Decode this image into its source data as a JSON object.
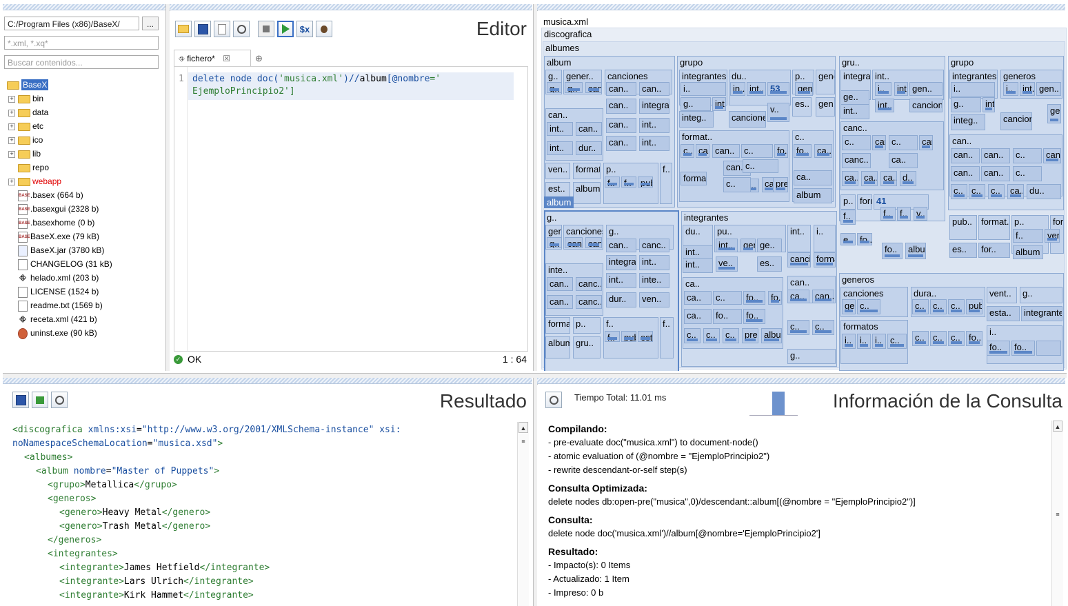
{
  "project": {
    "path": "C:/Program Files (x86)/BaseX/",
    "browse_label": "...",
    "filter_value": "*.xml, *.xq*",
    "search_placeholder": "Buscar contenidos...",
    "tree": [
      {
        "label": "BaseX",
        "kind": "folder",
        "selected": true,
        "expander": ""
      },
      {
        "label": "bin",
        "kind": "folder",
        "expander": "+"
      },
      {
        "label": "data",
        "kind": "folder",
        "expander": "+"
      },
      {
        "label": "etc",
        "kind": "folder",
        "expander": "+"
      },
      {
        "label": "ico",
        "kind": "folder",
        "expander": "+"
      },
      {
        "label": "lib",
        "kind": "folder",
        "expander": "+"
      },
      {
        "label": "repo",
        "kind": "folder",
        "expander": ""
      },
      {
        "label": "webapp",
        "kind": "folder",
        "expander": "+",
        "color": "#e00000"
      },
      {
        "label": ".basex (664 b)",
        "kind": "basex"
      },
      {
        "label": ".basexgui (2328 b)",
        "kind": "basex"
      },
      {
        "label": ".basexhome (0 b)",
        "kind": "basex"
      },
      {
        "label": "BaseX.exe (79 kB)",
        "kind": "basex"
      },
      {
        "label": "BaseX.jar (3780 kB)",
        "kind": "jar"
      },
      {
        "label": "CHANGELOG (31 kB)",
        "kind": "file"
      },
      {
        "label": "helado.xml (203 b)",
        "kind": "xml"
      },
      {
        "label": "LICENSE (1524 b)",
        "kind": "file"
      },
      {
        "label": "readme.txt (1569 b)",
        "kind": "txt"
      },
      {
        "label": "receta.xml (421 b)",
        "kind": "xml"
      },
      {
        "label": "uninst.exe (90 kB)",
        "kind": "exe"
      }
    ]
  },
  "editor": {
    "title": "Editor",
    "tab_label": "fichero*",
    "tab_close": "☒",
    "tab_add": "⊕",
    "line_number": "1",
    "code_line1_a": "delete node doc(",
    "code_line1_b": "'musica.xml'",
    "code_line1_c": ")//",
    "code_line1_d": "album",
    "code_line1_e": "[",
    "code_line1_f": "@nombre",
    "code_line1_g": "='",
    "code_line2": "EjemploPrincipio2']",
    "status_text": "OK",
    "cursor_pos": "1 : 64",
    "toolbar_icons": [
      "open-icon",
      "save-icon",
      "blank-icon",
      "find-icon",
      "stop-icon",
      "run-icon",
      "variables-icon",
      "debug-icon"
    ],
    "var_label": "$x"
  },
  "map": {
    "file": "musica.xml",
    "root": "discografica",
    "albumes": "albumes",
    "hover_label": "album",
    "cells": [
      {
        "t": "album"
      },
      {
        "t": "g.."
      },
      {
        "t": "gener.."
      },
      {
        "t": "canciones"
      },
      {
        "t": "g.."
      },
      {
        "t": "g.."
      },
      {
        "t": "can.."
      },
      {
        "t": "can.."
      },
      {
        "t": "can.."
      },
      {
        "t": "can.."
      },
      {
        "t": "integrantes"
      },
      {
        "t": "can.."
      },
      {
        "t": "can.."
      },
      {
        "t": "int.."
      },
      {
        "t": "int.."
      },
      {
        "t": "can.."
      },
      {
        "t": "can.."
      },
      {
        "t": "int.."
      },
      {
        "t": "int.."
      },
      {
        "t": "dur.."
      },
      {
        "t": "ven.."
      },
      {
        "t": "formatos"
      },
      {
        "t": "p.."
      },
      {
        "t": "f.."
      },
      {
        "t": "f.."
      },
      {
        "t": "f.."
      },
      {
        "t": "publ.."
      },
      {
        "t": "est.."
      },
      {
        "t": "album"
      },
      {
        "t": "grupo"
      },
      {
        "t": "integrantes"
      },
      {
        "t": "du.."
      },
      {
        "t": "p.."
      },
      {
        "t": "generos"
      },
      {
        "t": "i.."
      },
      {
        "t": "in.."
      },
      {
        "t": "int.."
      },
      {
        "t": "53"
      },
      {
        "t": "gen.."
      },
      {
        "t": "g.."
      },
      {
        "t": "int.."
      },
      {
        "t": "v.."
      },
      {
        "t": "es.."
      },
      {
        "t": "gen.."
      },
      {
        "t": "integ.."
      },
      {
        "t": "canciones"
      },
      {
        "t": "format.."
      },
      {
        "t": "c.."
      },
      {
        "t": "c.."
      },
      {
        "t": "ca.."
      },
      {
        "t": "can.."
      },
      {
        "t": "c.."
      },
      {
        "t": "fo.."
      },
      {
        "t": "fo.."
      },
      {
        "t": "ca.."
      },
      {
        "t": "can.."
      },
      {
        "t": "c.."
      },
      {
        "t": "c.."
      },
      {
        "t": "forma.."
      },
      {
        "t": "ca.."
      },
      {
        "t": "c.."
      },
      {
        "t": "ca.."
      },
      {
        "t": "precio"
      },
      {
        "t": "album"
      },
      {
        "t": "gru.."
      },
      {
        "t": "integrantes"
      },
      {
        "t": "int.."
      },
      {
        "t": "i.."
      },
      {
        "t": "int.."
      },
      {
        "t": "gen.."
      },
      {
        "t": "ge.."
      },
      {
        "t": "int.."
      },
      {
        "t": "int.."
      },
      {
        "t": "canciones"
      },
      {
        "t": "canc.."
      },
      {
        "t": "c.."
      },
      {
        "t": "canc.."
      },
      {
        "t": "c.."
      },
      {
        "t": "canc.."
      },
      {
        "t": "canc.."
      },
      {
        "t": "ca.."
      },
      {
        "t": "ca.."
      },
      {
        "t": "ca.."
      },
      {
        "t": "ca.."
      },
      {
        "t": "d.."
      },
      {
        "t": "p.."
      },
      {
        "t": "formatos"
      },
      {
        "t": "41"
      },
      {
        "t": "f.."
      },
      {
        "t": "f.."
      },
      {
        "t": "f.."
      },
      {
        "t": "v.."
      },
      {
        "t": "e.."
      },
      {
        "t": "fo.."
      },
      {
        "t": "fo.."
      },
      {
        "t": "album"
      },
      {
        "t": "grupo"
      },
      {
        "t": "integrantes"
      },
      {
        "t": "generos"
      },
      {
        "t": "i.."
      },
      {
        "t": "i.."
      },
      {
        "t": "int.."
      },
      {
        "t": "gen.."
      },
      {
        "t": "g.."
      },
      {
        "t": "int.."
      },
      {
        "t": "gen.."
      },
      {
        "t": "integ.."
      },
      {
        "t": "canciones"
      },
      {
        "t": "can.."
      },
      {
        "t": "can.."
      },
      {
        "t": "can.."
      },
      {
        "t": "c.."
      },
      {
        "t": "can.."
      },
      {
        "t": "can.."
      },
      {
        "t": "can.."
      },
      {
        "t": "c.."
      },
      {
        "t": "c.."
      },
      {
        "t": "c.."
      },
      {
        "t": "c.."
      },
      {
        "t": "ca.."
      },
      {
        "t": "du.."
      },
      {
        "t": "pub.."
      },
      {
        "t": "format.."
      },
      {
        "t": "p.."
      },
      {
        "t": "for.."
      },
      {
        "t": "f.."
      },
      {
        "t": "ven.."
      },
      {
        "t": "es.."
      },
      {
        "t": "for.."
      },
      {
        "t": "album"
      },
      {
        "t": "g.."
      },
      {
        "t": "generos"
      },
      {
        "t": "canciones"
      },
      {
        "t": "g.."
      },
      {
        "t": "g.."
      },
      {
        "t": "can.."
      },
      {
        "t": "canc.."
      },
      {
        "t": "can.."
      },
      {
        "t": "canc.."
      },
      {
        "t": "integrantes"
      },
      {
        "t": "int.."
      },
      {
        "t": "inte.."
      },
      {
        "t": "can.."
      },
      {
        "t": "canc.."
      },
      {
        "t": "int.."
      },
      {
        "t": "inte.."
      },
      {
        "t": "can.."
      },
      {
        "t": "canc.."
      },
      {
        "t": "dur.."
      },
      {
        "t": "ven.."
      },
      {
        "t": "formatos"
      },
      {
        "t": "p.."
      },
      {
        "t": "f.."
      },
      {
        "t": "f.."
      },
      {
        "t": "f.."
      },
      {
        "t": "publ.."
      },
      {
        "t": "est.."
      },
      {
        "t": "album"
      },
      {
        "t": "gru.."
      },
      {
        "t": "integrantes"
      },
      {
        "t": "du.."
      },
      {
        "t": "pu.."
      },
      {
        "t": "int.."
      },
      {
        "t": "i.."
      },
      {
        "t": "int.."
      },
      {
        "t": "gen.."
      },
      {
        "t": "ge.."
      },
      {
        "t": "int.."
      },
      {
        "t": "int.."
      },
      {
        "t": "ve.."
      },
      {
        "t": "es.."
      },
      {
        "t": "canciones"
      },
      {
        "t": "formatos"
      },
      {
        "t": "ca.."
      },
      {
        "t": "can.."
      },
      {
        "t": "ca.."
      },
      {
        "t": "c.."
      },
      {
        "t": "fo.."
      },
      {
        "t": "fo.."
      },
      {
        "t": "ca.."
      },
      {
        "t": "can.."
      },
      {
        "t": "ca.."
      },
      {
        "t": "fo.."
      },
      {
        "t": "fo.."
      },
      {
        "t": "c.."
      },
      {
        "t": "c.."
      },
      {
        "t": "c.."
      },
      {
        "t": "c.."
      },
      {
        "t": "c.."
      },
      {
        "t": "precio"
      },
      {
        "t": "album"
      },
      {
        "t": "g.."
      },
      {
        "t": "generos"
      },
      {
        "t": "canciones"
      },
      {
        "t": "dura.."
      },
      {
        "t": "vent.."
      },
      {
        "t": "g.."
      },
      {
        "t": "ge.."
      },
      {
        "t": "c.."
      },
      {
        "t": "c.."
      },
      {
        "t": "c.."
      },
      {
        "t": "c.."
      },
      {
        "t": "publ.."
      },
      {
        "t": "esta.."
      },
      {
        "t": "integrantes"
      },
      {
        "t": "formatos"
      },
      {
        "t": "i.."
      },
      {
        "t": "i.."
      },
      {
        "t": "i.."
      },
      {
        "t": "i.."
      },
      {
        "t": "c.."
      },
      {
        "t": "c.."
      },
      {
        "t": "c.."
      },
      {
        "t": "c.."
      },
      {
        "t": "fo.."
      },
      {
        "t": "fo.."
      },
      {
        "t": "fo.."
      }
    ]
  },
  "result": {
    "title": "Resultado",
    "lines": [
      {
        "indent": 0,
        "parts": [
          [
            "t",
            "<discografica "
          ],
          [
            "a",
            "xmlns:xsi"
          ],
          [
            "p",
            "="
          ],
          [
            "v",
            "\"http://www.w3.org/2001/XMLSchema-instance\""
          ],
          [
            "p",
            " "
          ],
          [
            "a",
            "xsi:"
          ]
        ]
      },
      {
        "indent": 0,
        "parts": [
          [
            "a",
            "noNamespaceSchemaLocation"
          ],
          [
            "p",
            "="
          ],
          [
            "v",
            "\"musica.xsd\""
          ],
          [
            "t",
            ">"
          ]
        ]
      },
      {
        "indent": 1,
        "parts": [
          [
            "t",
            "<albumes>"
          ]
        ]
      },
      {
        "indent": 2,
        "parts": [
          [
            "t",
            "<album "
          ],
          [
            "a",
            "nombre"
          ],
          [
            "p",
            "="
          ],
          [
            "v",
            "\"Master of Puppets\""
          ],
          [
            "t",
            ">"
          ]
        ]
      },
      {
        "indent": 3,
        "parts": [
          [
            "t",
            "<grupo>"
          ],
          [
            "p",
            "Metallica"
          ],
          [
            "t",
            "</grupo>"
          ]
        ]
      },
      {
        "indent": 3,
        "parts": [
          [
            "t",
            "<generos>"
          ]
        ]
      },
      {
        "indent": 4,
        "parts": [
          [
            "t",
            "<genero>"
          ],
          [
            "p",
            "Heavy Metal"
          ],
          [
            "t",
            "</genero>"
          ]
        ]
      },
      {
        "indent": 4,
        "parts": [
          [
            "t",
            "<genero>"
          ],
          [
            "p",
            "Trash Metal"
          ],
          [
            "t",
            "</genero>"
          ]
        ]
      },
      {
        "indent": 3,
        "parts": [
          [
            "t",
            "</generos>"
          ]
        ]
      },
      {
        "indent": 3,
        "parts": [
          [
            "t",
            "<integrantes>"
          ]
        ]
      },
      {
        "indent": 4,
        "parts": [
          [
            "t",
            "<integrante>"
          ],
          [
            "p",
            "James Hetfield"
          ],
          [
            "t",
            "</integrante>"
          ]
        ]
      },
      {
        "indent": 4,
        "parts": [
          [
            "t",
            "<integrante>"
          ],
          [
            "p",
            "Lars Ulrich"
          ],
          [
            "t",
            "</integrante>"
          ]
        ]
      },
      {
        "indent": 4,
        "parts": [
          [
            "t",
            "<integrante>"
          ],
          [
            "p",
            "Kirk Hammet"
          ],
          [
            "t",
            "</integrante>"
          ]
        ]
      }
    ]
  },
  "info": {
    "title": "Información de la Consulta",
    "total_time": "Tiempo Total: 11.01 ms",
    "sections": [
      {
        "heading": "Compilando:",
        "lines": [
          "- pre-evaluate doc(\"musica.xml\") to document-node()",
          "- atomic evaluation of (@nombre = \"EjemploPrincipio2\")",
          "- rewrite descendant-or-self step(s)"
        ]
      },
      {
        "heading": "Consulta Optimizada:",
        "lines": [
          "delete nodes db:open-pre(\"musica\",0)/descendant::album[(@nombre = \"EjemploPrincipio2\")]"
        ]
      },
      {
        "heading": "Consulta:",
        "lines": [
          "delete node doc('musica.xml')//album[@nombre='EjemploPrincipio2']"
        ]
      },
      {
        "heading": "Resultado:",
        "lines": [
          "- Impacto(s): 0 Items",
          "- Actualizado: 1 Item",
          "- Impreso: 0 b"
        ]
      }
    ]
  },
  "colors": {
    "accent": "#3a6fc4",
    "map_fill": "#c6d6ec",
    "map_border": "#8eaad2",
    "xml_tag": "#2e7d32",
    "xml_attr": "#1a4fa0",
    "xml_value": "#1a4fa0"
  }
}
